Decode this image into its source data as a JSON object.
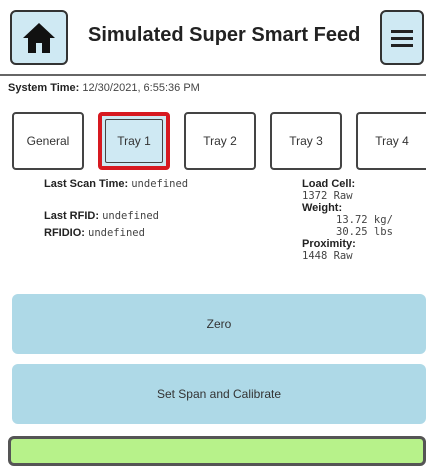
{
  "header": {
    "title": "Simulated Super Smart Feed",
    "home_icon": "home-icon",
    "menu_icon": "hamburger-menu-icon"
  },
  "system_time": {
    "label": "System Time:",
    "value": "12/30/2021, 6:55:36 PM"
  },
  "tabs": [
    {
      "label": "General",
      "active": false
    },
    {
      "label": "Tray 1",
      "active": true
    },
    {
      "label": "Tray 2",
      "active": false
    },
    {
      "label": "Tray 3",
      "active": false
    },
    {
      "label": "Tray 4",
      "active": false
    }
  ],
  "info": {
    "last_scan_time_label": "Last Scan Time:",
    "last_scan_time_value": "undefined",
    "last_rfid_label": "Last RFID:",
    "last_rfid_value": "undefined",
    "rfidio_label": "RFIDIO:",
    "rfidio_value": "undefined",
    "load_cell_label": "Load Cell:",
    "load_cell_value": "1372 Raw",
    "weight_label": "Weight:",
    "weight_kg": "13.72 kg/",
    "weight_lbs": "30.25 lbs",
    "proximity_label": "Proximity:",
    "proximity_value": "1448 Raw"
  },
  "actions": {
    "zero_label": "Zero",
    "span_label": "Set Span and Calibrate"
  },
  "colors": {
    "button_blue": "#aed9e7",
    "active_tab_border": "#d71920",
    "green_button": "#b7f28a"
  }
}
